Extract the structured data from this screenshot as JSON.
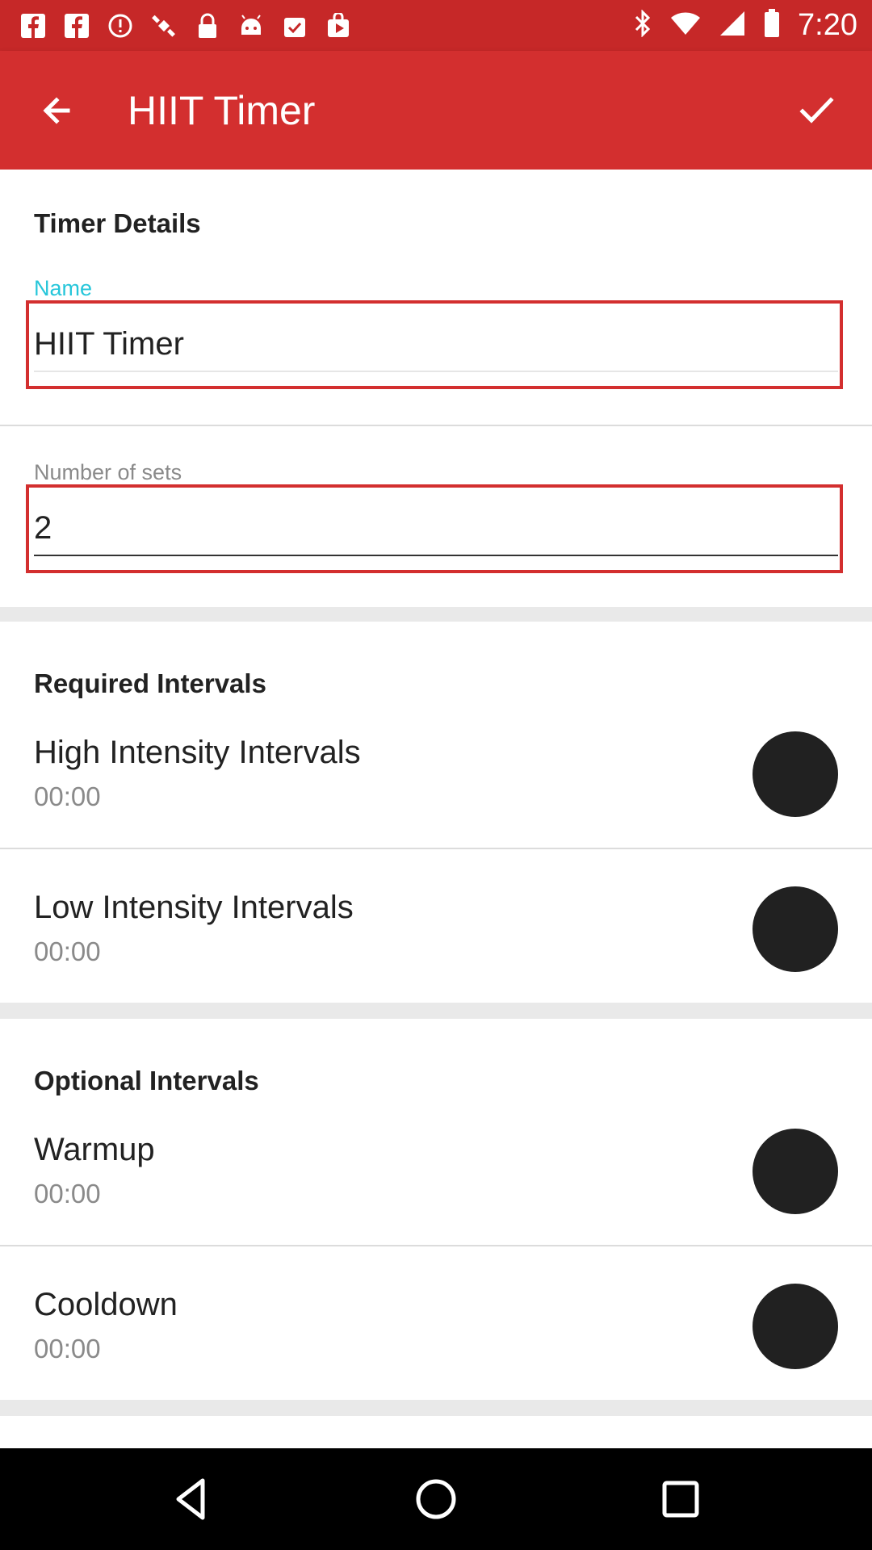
{
  "status_bar": {
    "time": "7:20",
    "left_icons": [
      "facebook-icon",
      "facebook-icon",
      "alert-icon",
      "satellite-icon",
      "lock-icon",
      "android-icon",
      "clipboard-check-icon",
      "play-store-icon"
    ],
    "right_icons": [
      "bluetooth-icon",
      "wifi-icon",
      "signal-icon",
      "battery-icon"
    ]
  },
  "app_bar": {
    "title": "HIIT Timer",
    "back_icon": "arrow-back-icon",
    "confirm_icon": "check-icon"
  },
  "timer_details": {
    "section_title": "Timer Details",
    "name": {
      "label": "Name",
      "value": "HIIT Timer"
    },
    "sets": {
      "label": "Number of sets",
      "value": "2"
    }
  },
  "required_intervals": {
    "section_title": "Required Intervals",
    "items": [
      {
        "title": "High Intensity Intervals",
        "time": "00:00"
      },
      {
        "title": "Low Intensity Intervals",
        "time": "00:00"
      }
    ]
  },
  "optional_intervals": {
    "section_title": "Optional Intervals",
    "items": [
      {
        "title": "Warmup",
        "time": "00:00"
      },
      {
        "title": "Cooldown",
        "time": "00:00"
      }
    ]
  },
  "colors": {
    "status_bar": "#c62828",
    "app_bar": "#d32f2f",
    "label_focused": "#26c6da",
    "highlight": "#d32f2f",
    "circle_button": "#212121"
  },
  "nav_bar": {
    "buttons": [
      "back-triangle-icon",
      "home-circle-icon",
      "recents-square-icon"
    ]
  }
}
